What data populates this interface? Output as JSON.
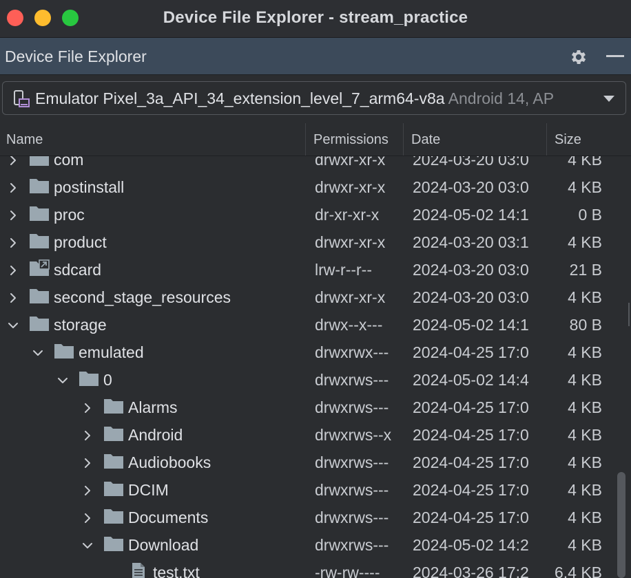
{
  "window": {
    "title": "Device File Explorer - stream_practice"
  },
  "tool": {
    "title": "Device File Explorer"
  },
  "device": {
    "name": "Emulator Pixel_3a_API_34_extension_level_7_arm64-v8a",
    "info": " Android 14, AP"
  },
  "columns": {
    "name": "Name",
    "permissions": "Permissions",
    "date": "Date",
    "size": "Size"
  },
  "rows": [
    {
      "name": "com",
      "permissions": "drwxr-xr-x",
      "date": "2024-03-20 03:0",
      "size": "4 KB",
      "depth": 0,
      "expanded": false,
      "type": "folder"
    },
    {
      "name": "postinstall",
      "permissions": "drwxr-xr-x",
      "date": "2024-03-20 03:0",
      "size": "4 KB",
      "depth": 0,
      "expanded": false,
      "type": "folder"
    },
    {
      "name": "proc",
      "permissions": "dr-xr-xr-x",
      "date": "2024-05-02 14:1",
      "size": "0 B",
      "depth": 0,
      "expanded": false,
      "type": "folder"
    },
    {
      "name": "product",
      "permissions": "drwxr-xr-x",
      "date": "2024-03-20 03:1",
      "size": "4 KB",
      "depth": 0,
      "expanded": false,
      "type": "folder"
    },
    {
      "name": "sdcard",
      "permissions": "lrw-r--r--",
      "date": "2024-03-20 03:0",
      "size": "21 B",
      "depth": 0,
      "expanded": false,
      "type": "link"
    },
    {
      "name": "second_stage_resources",
      "permissions": "drwxr-xr-x",
      "date": "2024-03-20 03:0",
      "size": "4 KB",
      "depth": 0,
      "expanded": false,
      "type": "folder"
    },
    {
      "name": "storage",
      "permissions": "drwx--x---",
      "date": "2024-05-02 14:1",
      "size": "80 B",
      "depth": 0,
      "expanded": true,
      "type": "folder"
    },
    {
      "name": "emulated",
      "permissions": "drwxrwx---",
      "date": "2024-04-25 17:0",
      "size": "4 KB",
      "depth": 1,
      "expanded": true,
      "type": "folder"
    },
    {
      "name": "0",
      "permissions": "drwxrws---",
      "date": "2024-05-02 14:4",
      "size": "4 KB",
      "depth": 2,
      "expanded": true,
      "type": "folder"
    },
    {
      "name": "Alarms",
      "permissions": "drwxrws---",
      "date": "2024-04-25 17:0",
      "size": "4 KB",
      "depth": 3,
      "expanded": false,
      "type": "folder"
    },
    {
      "name": "Android",
      "permissions": "drwxrws--x",
      "date": "2024-04-25 17:0",
      "size": "4 KB",
      "depth": 3,
      "expanded": false,
      "type": "folder"
    },
    {
      "name": "Audiobooks",
      "permissions": "drwxrws---",
      "date": "2024-04-25 17:0",
      "size": "4 KB",
      "depth": 3,
      "expanded": false,
      "type": "folder"
    },
    {
      "name": "DCIM",
      "permissions": "drwxrws---",
      "date": "2024-04-25 17:0",
      "size": "4 KB",
      "depth": 3,
      "expanded": false,
      "type": "folder"
    },
    {
      "name": "Documents",
      "permissions": "drwxrws---",
      "date": "2024-04-25 17:0",
      "size": "4 KB",
      "depth": 3,
      "expanded": false,
      "type": "folder"
    },
    {
      "name": "Download",
      "permissions": "drwxrws---",
      "date": "2024-05-02 14:2",
      "size": "4 KB",
      "depth": 3,
      "expanded": true,
      "type": "folder"
    },
    {
      "name": "test.txt",
      "permissions": "-rw-rw----",
      "date": "2024-03-26 17:2",
      "size": "6.4 KB",
      "depth": 4,
      "expanded": false,
      "type": "file"
    }
  ],
  "colors": {
    "background": "#2b2d30",
    "header": "#3c4a5a",
    "folder": "#9aa7b0",
    "text": "#dfe1e5"
  },
  "icons": {
    "settings": "gear-icon",
    "minimize": "minimize-icon",
    "device": "device-icon",
    "dropdown": "chevron-down-icon"
  }
}
